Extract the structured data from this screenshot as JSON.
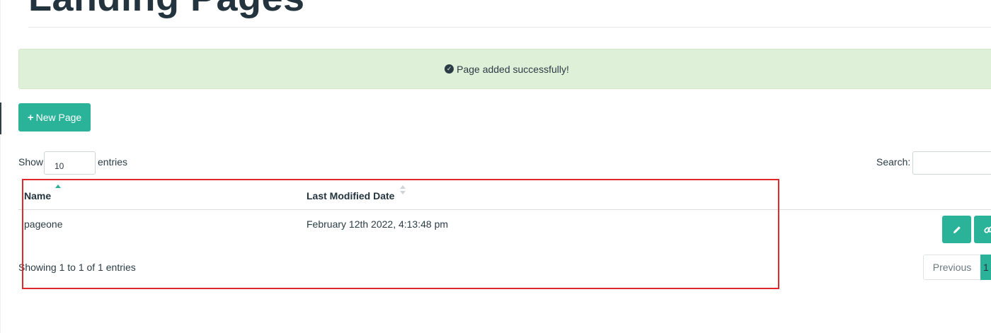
{
  "page": {
    "title": "Landing Pages"
  },
  "alert": {
    "icon": "check-circle-icon",
    "message": "Page added successfully!"
  },
  "toolbar": {
    "new_page_icon": "plus-icon",
    "new_page_label": "New Page"
  },
  "table_controls": {
    "show_label": "Show",
    "page_length": "10",
    "entries_label": "entries",
    "search_label": "Search:",
    "search_value": ""
  },
  "table": {
    "columns": [
      {
        "label": "Name",
        "sort": "ascending"
      },
      {
        "label": "Last Modified Date",
        "sort": "none"
      }
    ],
    "rows": [
      {
        "name": "pageone",
        "last_modified": "February 12th 2022, 4:13:48 pm",
        "actions": [
          "pencil-icon",
          "link-icon"
        ]
      }
    ]
  },
  "pagination": {
    "info": "Showing 1 to 1 of 1 entries",
    "previous_label": "Previous",
    "current_page": "1"
  },
  "colors": {
    "accent": "#2bb39a",
    "alert_background": "#dff0d8",
    "text": "#24343e",
    "annotation_box": "#e0282e"
  }
}
